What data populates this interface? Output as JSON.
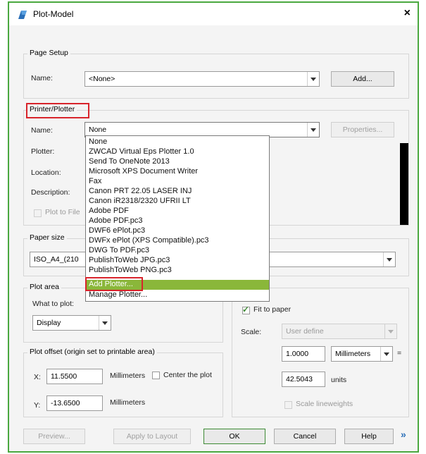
{
  "dialog": {
    "title": "Plot-Model",
    "close_glyph": "×"
  },
  "page_setup": {
    "legend": "Page Setup",
    "name_label": "Name:",
    "name_value": "<None>",
    "add_button": "Add..."
  },
  "printer": {
    "legend": "Printer/Plotter",
    "name_label": "Name:",
    "name_value": "None",
    "properties_button": "Properties...",
    "plotter_label": "Plotter:",
    "location_label": "Location:",
    "description_label": "Description:",
    "plot_to_file_label": "Plot to File",
    "dropdown_items": [
      "None",
      "ZWCAD Virtual Eps Plotter 1.0",
      "Send To OneNote 2013",
      "Microsoft XPS Document Writer",
      "Fax",
      "Canon PRT 22.05 LASER INJ",
      "Canon iR2318/2320 UFRII LT",
      "Adobe PDF",
      "Adobe PDF.pc3",
      "DWF6 ePlot.pc3",
      "DWFx ePlot (XPS Compatible).pc3",
      "DWG To PDF.pc3",
      "PublishToWeb JPG.pc3",
      "PublishToWeb PNG.pc3",
      "Add Plotter...",
      "Manage Plotter..."
    ],
    "highlighted_index": 14
  },
  "paper_size": {
    "legend": "Paper size",
    "value": "ISO_A4_(210"
  },
  "plot_area": {
    "legend": "Plot area",
    "what_label": "What to plot:",
    "what_value": "Display"
  },
  "plot_offset": {
    "legend": "Plot offset (origin set to printable area)",
    "x_label": "X:",
    "x_value": "11.5500",
    "x_unit": "Millimeters",
    "center_label": "Center the plot",
    "y_label": "Y:",
    "y_value": "-13.6500",
    "y_unit": "Millimeters"
  },
  "plot_scale": {
    "fit_label": "Fit to paper",
    "fit_checked": true,
    "scale_label": "Scale:",
    "scale_value": "User define",
    "scale_num": "1.0000",
    "unit_select": "Millimeters",
    "equals": "=",
    "units_num": "42.5043",
    "units_label": "units",
    "lineweights_label": "Scale lineweights"
  },
  "buttons": {
    "preview": "Preview...",
    "apply": "Apply to Layout",
    "ok": "OK",
    "cancel": "Cancel",
    "help": "Help",
    "more": "»"
  },
  "colors": {
    "accent_border": "#4aa83f",
    "highlight": "#8ab73a",
    "annotation_red": "#d8242b"
  }
}
